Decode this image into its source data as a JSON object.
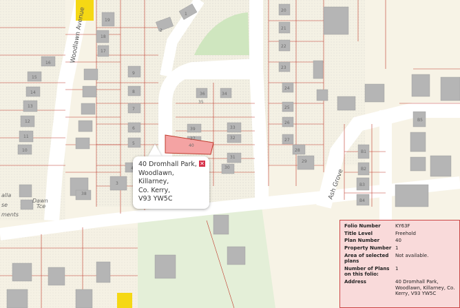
{
  "map": {
    "road_labels": {
      "woodlawn_avenue": "Woodlawn Avenue",
      "ash_grove": "Ash Grove"
    },
    "place_labels": {
      "dawn_tce": [
        "Dawn",
        "Tce"
      ],
      "left_edge": [
        "alla",
        "se",
        "ments"
      ]
    },
    "house_numbers": [
      "19",
      "18",
      "17",
      "16",
      "15",
      "14",
      "13",
      "12",
      "11",
      "10",
      "9",
      "8",
      "7",
      "6",
      "5",
      "4",
      "3",
      "2",
      "1",
      "20",
      "21",
      "22",
      "23",
      "24",
      "25",
      "26",
      "27",
      "28",
      "29",
      "30",
      "31",
      "32",
      "33",
      "34",
      "35",
      "36",
      "37",
      "38",
      "39",
      "40",
      "B1",
      "B2",
      "B3",
      "B4",
      "B5"
    ],
    "selected_parcel_color": "#f4a3a3",
    "colors": {
      "background": "#f7f3e6",
      "road": "#ffffff",
      "building": "#b5b5b5",
      "parcel_line": "#c0392b",
      "green": "#cfe6bf",
      "yellow_road": "#f5d814"
    }
  },
  "callout": {
    "lines": [
      "40 Dromhall Park,",
      "Woodlawn,",
      "Killarney,",
      "Co. Kerry,",
      "V93 YW5C"
    ],
    "close_icon": "close-icon"
  },
  "info_panel": {
    "rows": [
      {
        "key": "Folio Number",
        "value": "KY63F"
      },
      {
        "key": "Title Level",
        "value": "Freehold"
      },
      {
        "key": "Plan Number",
        "value": "40"
      },
      {
        "key": "Property Number",
        "value": "1"
      },
      {
        "key": "Area of selected plans",
        "value": "Not available."
      },
      {
        "key": "Number of Plans on this folio:",
        "value": "1"
      },
      {
        "key": "Address",
        "value": "40 Dromhall Park, Woodlawn, Killarney, Co. Kerry, V93 YW5C"
      }
    ]
  }
}
